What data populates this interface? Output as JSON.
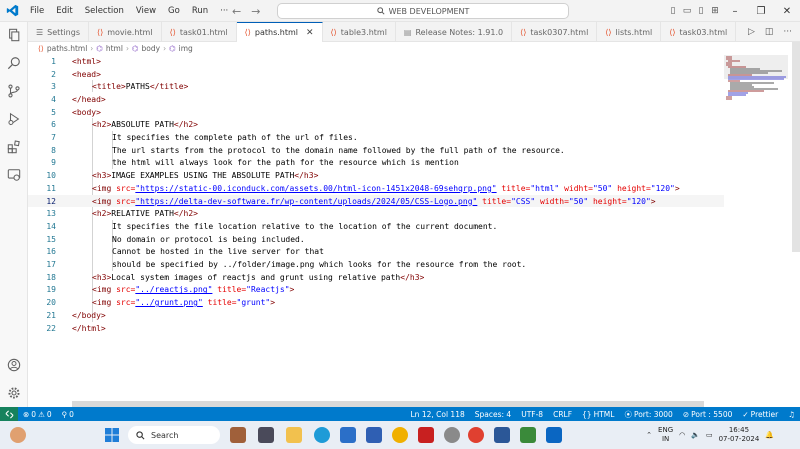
{
  "menu": [
    "File",
    "Edit",
    "Selection",
    "View",
    "Go",
    "Run"
  ],
  "search": {
    "text": "WEB DEVELOPMENT"
  },
  "tabs": [
    {
      "label": "Settings",
      "icon": "settings-icon",
      "active": false
    },
    {
      "label": "movie.html",
      "icon": "html-file-icon",
      "active": false
    },
    {
      "label": "task01.html",
      "icon": "html-file-icon",
      "active": false
    },
    {
      "label": "paths.html",
      "icon": "html-file-icon",
      "active": true
    },
    {
      "label": "table3.html",
      "icon": "html-file-icon",
      "active": false
    },
    {
      "label": "Release Notes: 1.91.0",
      "icon": "doc-icon",
      "active": false
    },
    {
      "label": "task0307.html",
      "icon": "html-file-icon",
      "active": false
    },
    {
      "label": "lists.html",
      "icon": "html-file-icon",
      "active": false
    },
    {
      "label": "task03.html",
      "icon": "html-file-icon",
      "active": false
    }
  ],
  "breadcrumb": [
    "paths.html",
    "html",
    "body",
    "img"
  ],
  "line_numbers": [
    "1",
    "2",
    "3",
    "4",
    "5",
    "6",
    "7",
    "8",
    "9",
    "10",
    "11",
    "12",
    "13",
    "14",
    "15",
    "16",
    "17",
    "18",
    "19",
    "20",
    "21",
    "22"
  ],
  "code": {
    "l1_tag": "<html>",
    "l2_tag": "<head>",
    "l3_open": "<title>",
    "l3_text": "PATHS",
    "l3_close": "</title>",
    "l4_tag": "</head>",
    "l5_tag": "<body>",
    "l6_open": "<h2>",
    "l6_text": "ABSOLUTE PATH",
    "l6_close": "</h2>",
    "l7_text": "It specifies the complete path of the url of files.",
    "l8_text": "The url starts from the protocol to the domain name followed by the full path of the resource.",
    "l9_text": "the html will always look for the path for the resource which is mention",
    "l10_open": "<h3>",
    "l10_text": "IMAGE EXAMPLES USING THE ABSOLUTE PATH",
    "l10_close": "</h3>",
    "l11_tag": "<img",
    "l11_a1": "src=",
    "l11_v1": "\"https://static-00.iconduck.com/assets.00/html-icon-1451x2048-69sehqrp.png\"",
    "l11_a2": "title=",
    "l11_v2": "\"html\"",
    "l11_a3": "widht=",
    "l11_v3": "\"50\"",
    "l11_a4": "height=",
    "l11_v4": "\"120\"",
    "l11_end": ">",
    "l12_tag": "<img",
    "l12_a1": "src=",
    "l12_v1": "\"https://delta-dev-software.fr/wp-content/uploads/2024/05/CSS-Logo.png\"",
    "l12_a2": "title=",
    "l12_v2": "\"CSS\"",
    "l12_a3": "width=",
    "l12_v3": "\"50\"",
    "l12_a4": "height=",
    "l12_v4": "\"120\"",
    "l12_end": ">",
    "l13_open": "<h2>",
    "l13_text": "RELATIVE PATH",
    "l13_close": "</h2>",
    "l14_text": "It specifies the file location relative to the location of the current document.",
    "l15_text": "No domain or protocol is being included.",
    "l16_text": "Cannot be hosted in the live server for that",
    "l17_text": "should be specified by ../folder/image.png which looks for the resource from the root.",
    "l18_open": "<h3>",
    "l18_text": "Local system images of reactjs and grunt using relative path",
    "l18_close": "</h3>",
    "l19_tag": "<img",
    "l19_a1": "src=",
    "l19_v1": "\"../reactjs.png\"",
    "l19_a2": "title=",
    "l19_v2": "\"Reactjs\"",
    "l19_end": ">",
    "l20_tag": "<img",
    "l20_a1": "src=",
    "l20_v1": "\"../grunt.png\"",
    "l20_a2": "title=",
    "l20_v2": "\"grunt\"",
    "l20_end": ">",
    "l21_tag": "</body>",
    "l22_tag": "</html>"
  },
  "status": {
    "errors": "0",
    "warnings": "0",
    "info": "0",
    "position": "Ln 12, Col 118",
    "spaces": "Spaces: 4",
    "encoding": "UTF-8",
    "eol": "CRLF",
    "language": "HTML",
    "port": "Port: 3000",
    "port2": "Port : 5500",
    "prettier": "Prettier"
  },
  "taskbar": {
    "search": "Search",
    "lang1": "ENG",
    "lang2": "IN",
    "time": "16:45",
    "date": "07-07-2024"
  },
  "colors": {
    "accent": "#007acc",
    "tag": "#800000",
    "attr": "#e50000",
    "string": "#0000ff"
  }
}
